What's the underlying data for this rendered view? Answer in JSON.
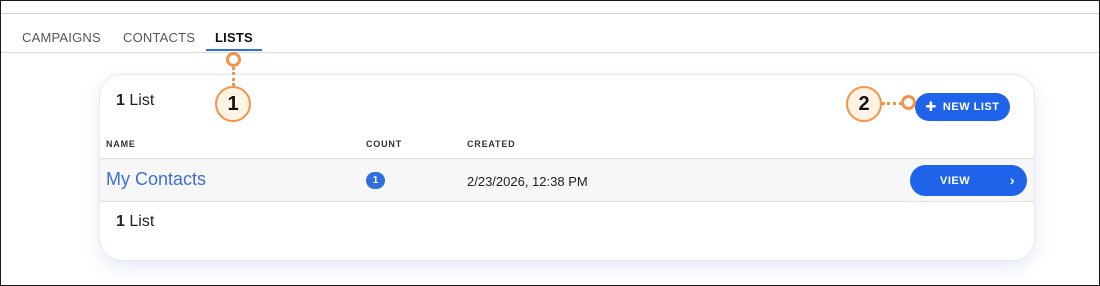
{
  "tabs": [
    {
      "label": "CAMPAIGNS",
      "active": false
    },
    {
      "label": "CONTACTS",
      "active": false
    },
    {
      "label": "LISTS",
      "active": true
    }
  ],
  "header": {
    "count_number": "1",
    "count_word": "List",
    "new_list_label": "NEW LIST",
    "new_list_icon": "plus-icon"
  },
  "table": {
    "columns": [
      "NAME",
      "COUNT",
      "CREATED"
    ],
    "rows": [
      {
        "name": "My Contacts",
        "count": "1",
        "created": "2/23/2026, 12:38 PM",
        "action_label": "VIEW",
        "action_icon": "chevron-right-icon"
      }
    ]
  },
  "footer": {
    "count_number": "1",
    "count_word": "List"
  },
  "callouts": [
    {
      "number": "1"
    },
    {
      "number": "2"
    }
  ],
  "colors": {
    "primary": "#1e63ea",
    "link": "#3b6fd6",
    "callout": "#f2944a",
    "callout_fill": "#fff4e4"
  }
}
